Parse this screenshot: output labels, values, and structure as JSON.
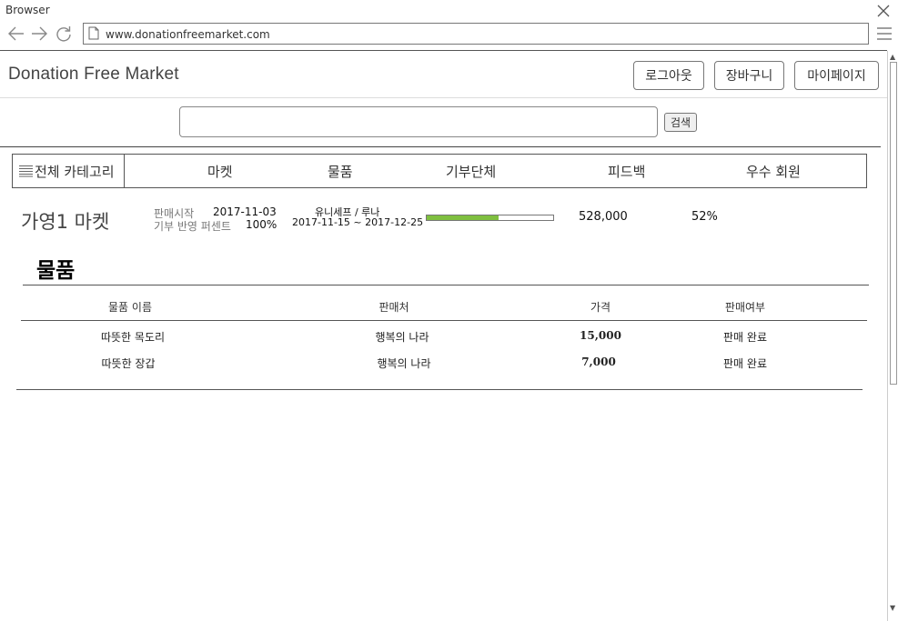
{
  "browser": {
    "title": "Browser",
    "url": "www.donationfreemarket.com"
  },
  "header": {
    "site_title": "Donation Free Market",
    "buttons": {
      "logout": "로그아웃",
      "cart": "장바구니",
      "mypage": "마이페이지"
    }
  },
  "search": {
    "value": "",
    "button_label": "검색"
  },
  "nav": {
    "all_categories": "전체 카테고리",
    "items": [
      "마켓",
      "물품",
      "기부단체",
      "피드백",
      "우수 회원"
    ]
  },
  "market": {
    "name": "가영1 마켓",
    "sale_start_label": "판매시작",
    "sale_start_value": "2017-11-03",
    "donation_percent_label": "기부 반영 퍼센트",
    "donation_percent_value": "100%",
    "organization": "유니세프 / 루나",
    "period": "2017-11-15 ~ 2017-12-25",
    "progress_fraction": 0.57,
    "progress_color": "#7fbf3f",
    "amount": "528,000",
    "percent": "52%"
  },
  "goods": {
    "section_title": "물품",
    "columns": [
      "물품 이름",
      "판매처",
      "가격",
      "판매여부"
    ],
    "rows": [
      [
        "따뜻한 목도리",
        "행복의 나라",
        "15,000",
        "판매 완료"
      ],
      [
        "따뜻한 장갑",
        "행복의 나라",
        "7,000",
        "판매 완료"
      ]
    ]
  }
}
